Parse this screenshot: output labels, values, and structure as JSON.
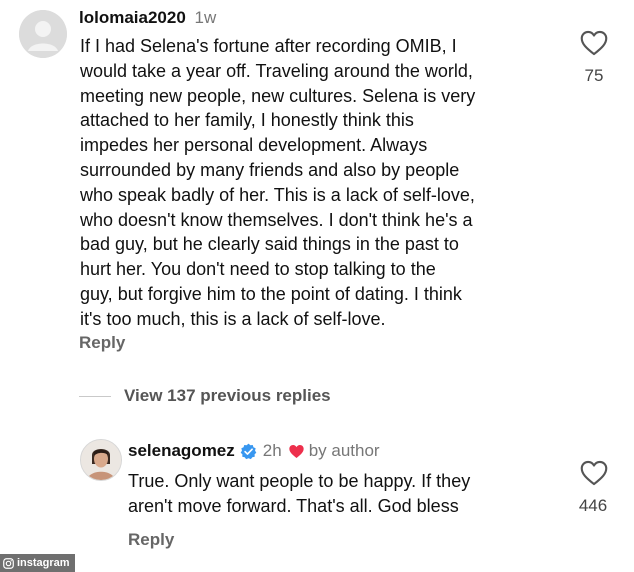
{
  "comment": {
    "username": "lolomaia2020",
    "time_ago": "1w",
    "lines": [
      "If I had Selena's fortune after recording OMIB, I",
      "would take a year off. Traveling around the world,",
      "meeting new people, new cultures. Selena is very",
      "attached to her family, I honestly think this",
      "impedes her personal development. Always",
      "surrounded by many friends and also by people",
      "who speak badly of her. This is a lack of self-love,",
      "who doesn't know themselves. I don't think he's a",
      "bad guy, but he clearly said things in the past to",
      "hurt her. You don't need to stop talking to the",
      "guy, but forgive him to the point of dating. I think",
      "it's too much, this is a lack of self-love."
    ],
    "likes": "75",
    "reply_label": "Reply"
  },
  "view_replies": "View 137 previous replies",
  "reply": {
    "username": "selenagomez",
    "time_ago": "2h",
    "author_badge": "by author",
    "lines": [
      "True. Only want people to be happy. If they",
      "aren't move forward. That's all. God bless"
    ],
    "likes": "446",
    "reply_label": "Reply"
  },
  "watermark": "instagram",
  "colors": {
    "heart_red": "#ed2f4c",
    "verified_blue": "#3897f0"
  }
}
